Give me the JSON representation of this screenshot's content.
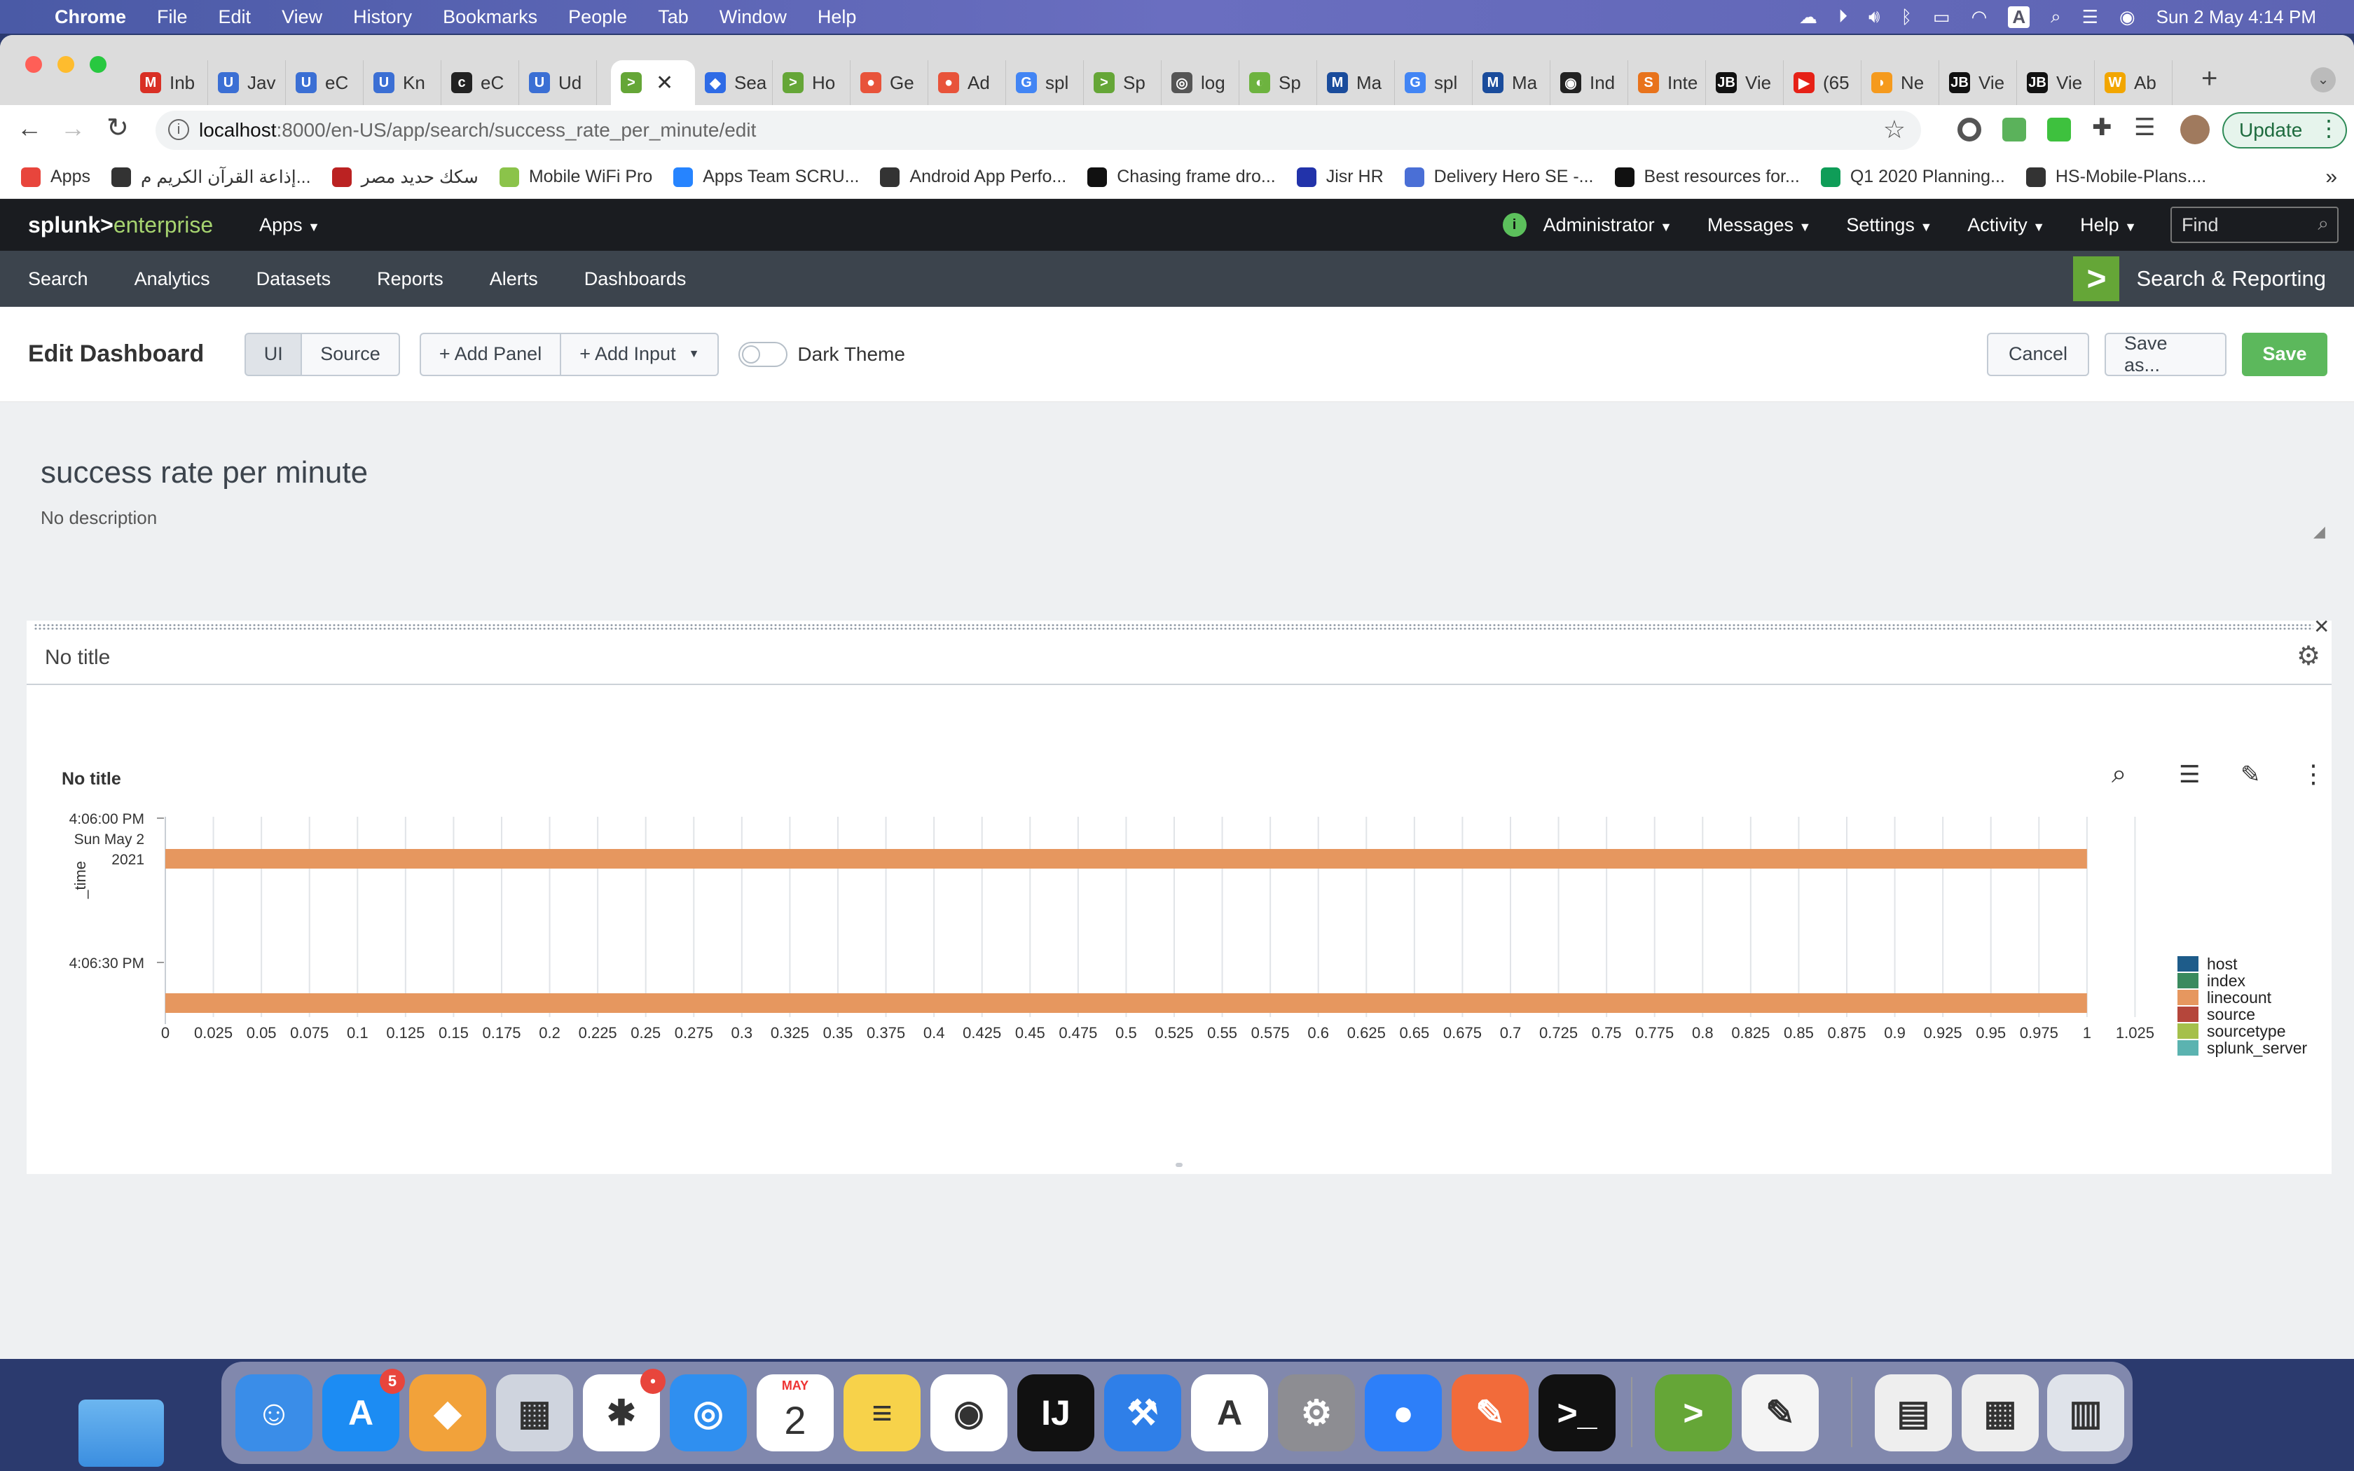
{
  "menubar": {
    "app": "Chrome",
    "items": [
      "File",
      "Edit",
      "View",
      "History",
      "Bookmarks",
      "People",
      "Tab",
      "Window",
      "Help"
    ],
    "datetime": "Sun 2 May  4:14 PM"
  },
  "tabs": [
    {
      "label": "Inb",
      "color": "#d93025",
      "icon": "M"
    },
    {
      "label": "Jav",
      "color": "#3b6fd4",
      "icon": "U"
    },
    {
      "label": "eC",
      "color": "#3b6fd4",
      "icon": "U"
    },
    {
      "label": "Kn",
      "color": "#3b6fd4",
      "icon": "U"
    },
    {
      "label": "eC",
      "color": "#222",
      "icon": "c"
    },
    {
      "label": "Ud",
      "color": "#3b6fd4",
      "icon": "U"
    },
    {
      "label": "Sea",
      "color": "#2e6be6",
      "icon": "◆"
    },
    {
      "label": "Ho",
      "color": "#65a637",
      "icon": ">"
    },
    {
      "label": "Ge",
      "color": "#e8533a",
      "icon": "●"
    },
    {
      "label": "Ad",
      "color": "#e8533a",
      "icon": "●"
    },
    {
      "label": "spl",
      "color": "#4285f4",
      "icon": "G"
    },
    {
      "label": "Sp",
      "color": "#65a637",
      "icon": ">"
    },
    {
      "label": "log",
      "color": "#555",
      "icon": "◎"
    },
    {
      "label": "Sp",
      "color": "#6db33f",
      "icon": "◐"
    },
    {
      "label": "Ma",
      "color": "#1a4c9c",
      "icon": "M"
    },
    {
      "label": "spl",
      "color": "#4285f4",
      "icon": "G"
    },
    {
      "label": "Ma",
      "color": "#1a4c9c",
      "icon": "M"
    },
    {
      "label": "Ind",
      "color": "#222",
      "icon": "◉"
    },
    {
      "label": "Inte",
      "color": "#e8731c",
      "icon": "S"
    },
    {
      "label": "Vie",
      "color": "#111",
      "icon": "JB"
    },
    {
      "label": "(65",
      "color": "#e62117",
      "icon": "▶"
    },
    {
      "label": "Ne",
      "color": "#f59a1d",
      "icon": "◗"
    },
    {
      "label": "Vie",
      "color": "#111",
      "icon": "JB"
    },
    {
      "label": "Vie",
      "color": "#111",
      "icon": "JB"
    },
    {
      "label": "Ab",
      "color": "#f2a600",
      "icon": "W"
    }
  ],
  "active_tab": {
    "icon": ">",
    "color": "#65a637"
  },
  "url": {
    "host": "localhost",
    "path": ":8000/en-US/app/search/success_rate_per_minute/edit"
  },
  "update_label": "Update",
  "bookmarks": [
    {
      "label": "Apps",
      "color": "#e8453c"
    },
    {
      "label": "إذاعة القرآن الكريم م...",
      "color": "#333"
    },
    {
      "label": "سكك حديد مصر",
      "color": "#b22"
    },
    {
      "label": "Mobile WiFi Pro",
      "color": "#8bc34a"
    },
    {
      "label": "Apps Team SCRU...",
      "color": "#2684ff"
    },
    {
      "label": "Android App Perfo...",
      "color": "#333"
    },
    {
      "label": "Chasing frame dro...",
      "color": "#111"
    },
    {
      "label": "Jisr HR",
      "color": "#2233aa"
    },
    {
      "label": "Delivery Hero SE -...",
      "color": "#4a6fd6"
    },
    {
      "label": "Best resources for...",
      "color": "#111"
    },
    {
      "label": "Q1 2020 Planning...",
      "color": "#0f9d58"
    },
    {
      "label": "HS-Mobile-Plans....",
      "color": "#333"
    }
  ],
  "splunk": {
    "logo_a": "splunk>",
    "logo_b": "enterprise",
    "apps": "Apps",
    "user": "Administrator",
    "messages": "Messages",
    "settings": "Settings",
    "activity": "Activity",
    "help": "Help",
    "find_placeholder": "Find",
    "nav": [
      "Search",
      "Analytics",
      "Datasets",
      "Reports",
      "Alerts",
      "Dashboards"
    ],
    "app_name": "Search & Reporting"
  },
  "edit": {
    "title": "Edit Dashboard",
    "ui": "UI",
    "source": "Source",
    "add_panel": "+ Add Panel",
    "add_input": "+ Add Input",
    "dark_theme": "Dark Theme",
    "cancel": "Cancel",
    "save_as": "Save as...",
    "save": "Save"
  },
  "dashboard": {
    "title": "success rate per minute",
    "description": "No description",
    "panel_title": "No title",
    "viz_title": "No title"
  },
  "chart_data": {
    "type": "bar",
    "orientation": "horizontal",
    "ylabel": "_time",
    "y_categories": [
      [
        "4:06:00 PM",
        "Sun May 2",
        "2021"
      ],
      [
        "4:06:30 PM"
      ]
    ],
    "x_ticks": [
      "0",
      "0.025",
      "0.05",
      "0.075",
      "0.1",
      "0.125",
      "0.15",
      "0.175",
      "0.2",
      "0.225",
      "0.25",
      "0.275",
      "0.3",
      "0.325",
      "0.35",
      "0.375",
      "0.4",
      "0.425",
      "0.45",
      "0.475",
      "0.5",
      "0.525",
      "0.55",
      "0.575",
      "0.6",
      "0.625",
      "0.65",
      "0.675",
      "0.7",
      "0.725",
      "0.75",
      "0.775",
      "0.8",
      "0.825",
      "0.85",
      "0.875",
      "0.9",
      "0.925",
      "0.95",
      "0.975",
      "1",
      "1.025"
    ],
    "xlim": [
      0,
      1.05
    ],
    "series": [
      {
        "name": "host",
        "color": "#1e5c8a",
        "values": []
      },
      {
        "name": "index",
        "color": "#3a8a5e",
        "values": []
      },
      {
        "name": "linecount",
        "color": "#e6975f",
        "values": [
          1,
          1
        ]
      },
      {
        "name": "source",
        "color": "#b5463b",
        "values": []
      },
      {
        "name": "sourcetype",
        "color": "#a5c04b",
        "values": []
      },
      {
        "name": "splunk_server",
        "color": "#5bb3b0",
        "values": []
      }
    ],
    "legend": "right"
  },
  "dock": [
    {
      "name": "Finder",
      "color": "#3a8de8",
      "glyph": "☺"
    },
    {
      "name": "App Store",
      "color": "#1c8cf3",
      "glyph": "A",
      "badge": "5"
    },
    {
      "name": "Blimp",
      "color": "#f2a23a",
      "glyph": "◆"
    },
    {
      "name": "Launchpad",
      "color": "#cfd4de",
      "glyph": "▦"
    },
    {
      "name": "Slack",
      "color": "#fff",
      "glyph": "✱",
      "badge": "•"
    },
    {
      "name": "Safari",
      "color": "#2f8ff0",
      "glyph": "◎"
    },
    {
      "name": "Calendar",
      "color": "#fff",
      "glyph": "2",
      "month": "MAY"
    },
    {
      "name": "Notes",
      "color": "#f7d24a",
      "glyph": "≡"
    },
    {
      "name": "Chrome",
      "color": "#fff",
      "glyph": "◉"
    },
    {
      "name": "IntelliJ",
      "color": "#111",
      "glyph": "IJ"
    },
    {
      "name": "Xcode",
      "color": "#2f7fe8",
      "glyph": "⚒"
    },
    {
      "name": "Android Studio",
      "color": "#fff",
      "glyph": "A"
    },
    {
      "name": "System Preferences",
      "color": "#8d8d92",
      "glyph": "⚙"
    },
    {
      "name": "Location",
      "color": "#2d7ff9",
      "glyph": "●"
    },
    {
      "name": "Postman",
      "color": "#f26b3a",
      "glyph": "✎"
    },
    {
      "name": "Terminal",
      "color": "#111",
      "glyph": ">_"
    },
    {
      "name": "Splunk",
      "color": "#65a637",
      "glyph": ">"
    },
    {
      "name": "TextEdit",
      "color": "#f4f4f4",
      "glyph": "✎"
    },
    {
      "name": "Documents",
      "color": "#eee",
      "glyph": "▤"
    },
    {
      "name": "Calendar Doc",
      "color": "#eee",
      "glyph": "▦"
    },
    {
      "name": "Trash",
      "color": "#dfe3ea",
      "glyph": "▥"
    }
  ]
}
